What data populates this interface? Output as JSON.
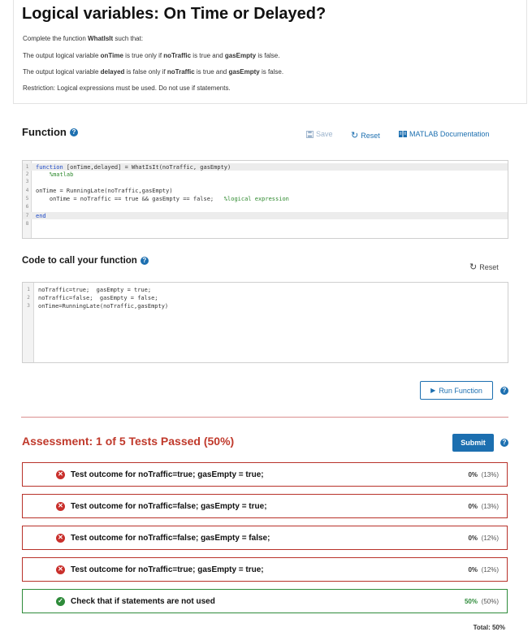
{
  "problem": {
    "title": "Logical variables: On Time or Delayed?",
    "intro_prefix": "Complete the function ",
    "function_name": "WhatIsIt",
    "intro_suffix": " such that:",
    "line1_prefix": "The output logical variable ",
    "line1_var": "onTime",
    "line1_mid": " is true only if ",
    "line1_cond1": "noTraffic",
    "line1_mid2": " is true and ",
    "line1_cond2": "gasEmpty",
    "line1_suffix": " is false.",
    "line2_prefix": "The output logical variable ",
    "line2_var": "delayed",
    "line2_mid": " is false only if ",
    "line2_cond1": "noTraffic",
    "line2_mid2": " is true and ",
    "line2_cond2": "gasEmpty",
    "line2_suffix": " is false.",
    "restriction": "Restriction:  Logical expressions must be used.  Do not use if statements."
  },
  "function_section": {
    "heading": "Function",
    "help_icon": "?",
    "save_label": "Save",
    "reset_label": "Reset",
    "doc_label": "MATLAB Documentation"
  },
  "function_code": [
    {
      "num": "1",
      "kw": "function",
      "text": " [onTime,delayed] = WhatIsIt(noTraffic, gasEmpty)",
      "comment": ""
    },
    {
      "num": "2",
      "kw": "",
      "text": "    ",
      "comment": "%matlab"
    },
    {
      "num": "3",
      "kw": "",
      "text": "",
      "comment": ""
    },
    {
      "num": "4",
      "kw": "",
      "text": "onTime = RunningLate(noTraffic,gasEmpty)",
      "comment": ""
    },
    {
      "num": "5",
      "kw": "",
      "text": "    onTime = noTraffic == true && gasEmpty == false;   ",
      "comment": "%logical expression"
    },
    {
      "num": "6",
      "kw": "",
      "text": "",
      "comment": ""
    },
    {
      "num": "7",
      "kw": "end",
      "text": "",
      "comment": ""
    },
    {
      "num": "8",
      "kw": "",
      "text": "",
      "comment": ""
    }
  ],
  "call_section": {
    "heading": "Code to call your function",
    "help_icon": "?",
    "reset_label": "Reset"
  },
  "call_code": [
    {
      "num": "1",
      "text": "noTraffic=true;  gasEmpty = true;"
    },
    {
      "num": "2",
      "text": "noTraffic=false;  gasEmpty = false;"
    },
    {
      "num": "3",
      "text": "onTime=RunningLate(noTraffic,gasEmpty)"
    }
  ],
  "run_button": {
    "label": "Run Function",
    "help_icon": "?"
  },
  "assessment": {
    "title": "Assessment: 1 of 5 Tests Passed (50%)",
    "submit_label": "Submit",
    "help_icon": "?",
    "tests": [
      {
        "label": "Test outcome for noTraffic=true; gasEmpty = true;",
        "score": "0%",
        "weight": "(13%)",
        "passed": false
      },
      {
        "label": "Test outcome for noTraffic=false; gasEmpty = true;",
        "score": "0%",
        "weight": "(13%)",
        "passed": false
      },
      {
        "label": "Test outcome for noTraffic=false; gasEmpty = false;",
        "score": "0%",
        "weight": "(12%)",
        "passed": false
      },
      {
        "label": "Test outcome for noTraffic=true; gasEmpty = true;",
        "score": "0%",
        "weight": "(12%)",
        "passed": false
      },
      {
        "label": "Check that if statements are not used",
        "score": "50%",
        "weight": "(50%)",
        "passed": true
      }
    ],
    "total": "Total:   50%"
  },
  "colors": {
    "accent": "#1c6fb0",
    "fail": "#c0392b",
    "pass": "#2e8b3a"
  }
}
